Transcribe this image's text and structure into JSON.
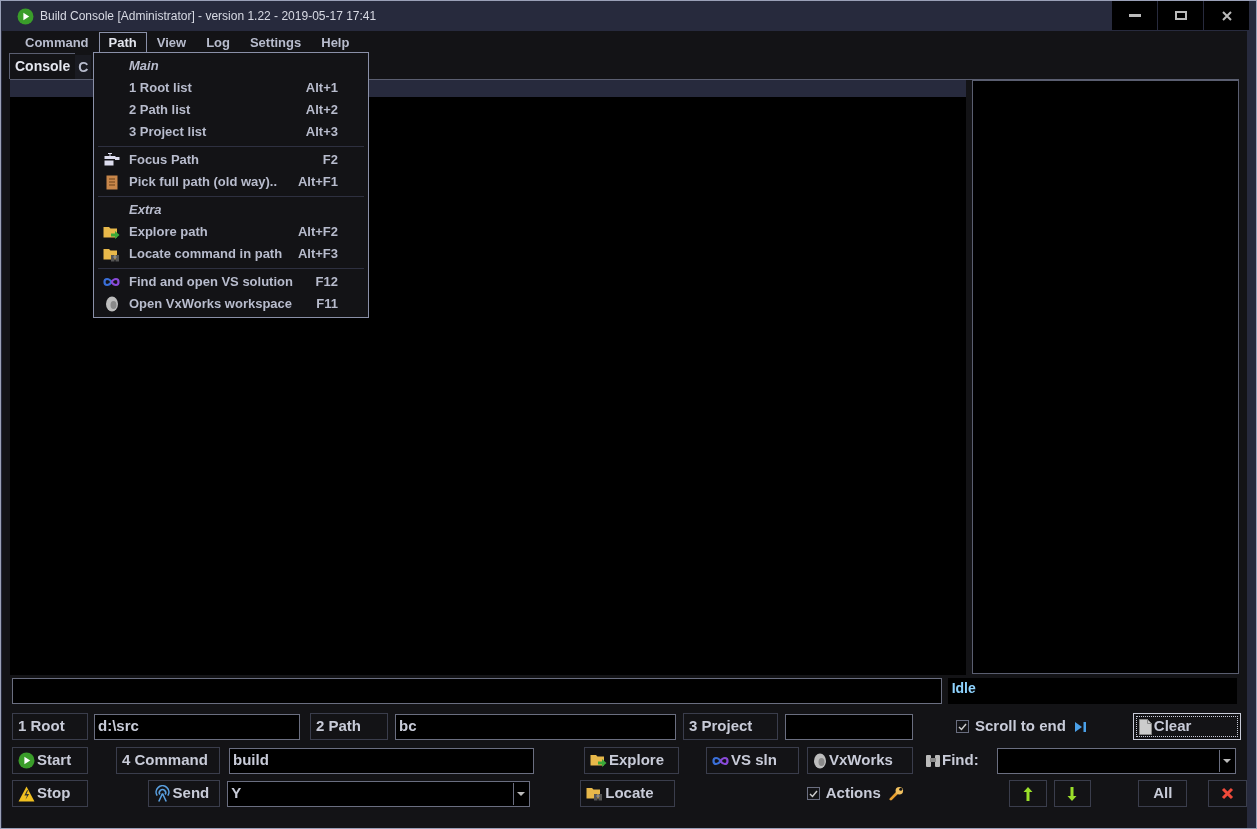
{
  "window": {
    "title": "Build Console [Administrator] - version 1.22 - 2019-05-17 17:41"
  },
  "menu_bar": [
    {
      "label": "Command",
      "selected": false
    },
    {
      "label": "Path",
      "selected": true
    },
    {
      "label": "View",
      "selected": false
    },
    {
      "label": "Log",
      "selected": false
    },
    {
      "label": "Settings",
      "selected": false
    },
    {
      "label": "Help",
      "selected": false
    }
  ],
  "path_menu": [
    {
      "kind": "header",
      "label": "Main"
    },
    {
      "kind": "item",
      "label": "1 Root list",
      "shortcut": "Alt+1"
    },
    {
      "kind": "item",
      "label": "2 Path list",
      "shortcut": "Alt+2"
    },
    {
      "kind": "item",
      "label": "3 Project list",
      "shortcut": "Alt+3"
    },
    {
      "kind": "separator"
    },
    {
      "kind": "item",
      "label": "Focus Path",
      "shortcut": "F2"
    },
    {
      "kind": "item",
      "label": "Pick full path (old way)..",
      "shortcut": "Alt+F1"
    },
    {
      "kind": "separator"
    },
    {
      "kind": "header",
      "label": "Extra"
    },
    {
      "kind": "item",
      "label": "Explore path",
      "shortcut": "Alt+F2"
    },
    {
      "kind": "item",
      "label": "Locate command in path",
      "shortcut": "Alt+F3"
    },
    {
      "kind": "separator"
    },
    {
      "kind": "item",
      "label": "Find and open VS solution",
      "shortcut": "F12"
    },
    {
      "kind": "item",
      "label": "Open VxWorks workspace",
      "shortcut": "F11"
    }
  ],
  "tabs": [
    {
      "label": "Console",
      "selected": true
    },
    {
      "label": "C",
      "selected": false
    }
  ],
  "status": {
    "text": "Idle"
  },
  "root": {
    "label": "1 Root",
    "value": "d:\\src"
  },
  "path": {
    "label": "2 Path",
    "value": "bc"
  },
  "project": {
    "label": "3 Project"
  },
  "scroll_to_end": {
    "label": "Scroll to end",
    "checked": true
  },
  "clear": {
    "label": "Clear"
  },
  "start": {
    "label": "Start"
  },
  "command": {
    "label": "4 Command",
    "value": "build"
  },
  "explore": {
    "label": "Explore"
  },
  "vs_sln": {
    "label": "VS sln"
  },
  "vxworks": {
    "label": "VxWorks"
  },
  "find": {
    "label": "Find:"
  },
  "stop": {
    "label": "Stop"
  },
  "send": {
    "label": "Send",
    "value": "Y"
  },
  "locate": {
    "label": "Locate"
  },
  "actions": {
    "label": "Actions",
    "checked": true
  },
  "all": {
    "label": "All"
  }
}
